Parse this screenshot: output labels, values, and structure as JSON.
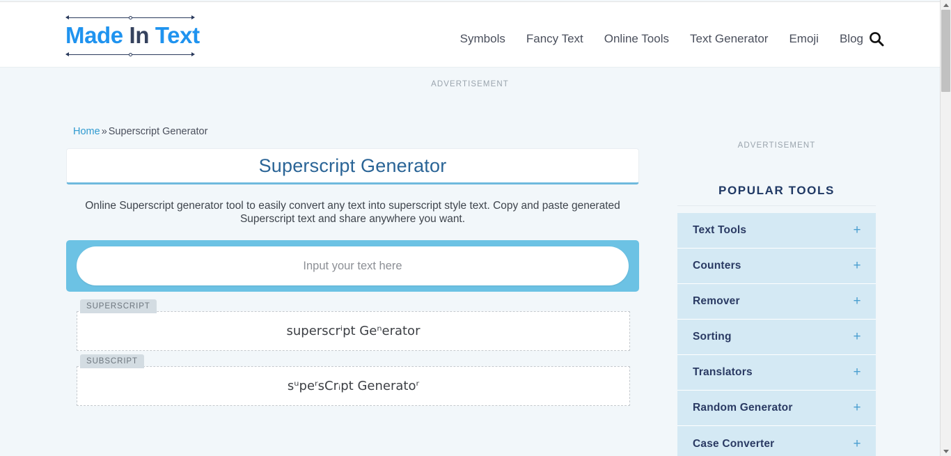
{
  "browser": {
    "scrollbar": {
      "up_arrow_icon": "chevron-up-icon",
      "down_arrow_icon": "chevron-down-icon"
    }
  },
  "header": {
    "logo": {
      "part1": "Made",
      "part2": "In",
      "part3": "Text",
      "color_primary": "#1f93ef",
      "color_secondary": "#35425e"
    },
    "nav": [
      {
        "label": "Symbols"
      },
      {
        "label": "Fancy Text"
      },
      {
        "label": "Online Tools"
      },
      {
        "label": "Text Generator"
      },
      {
        "label": "Emoji"
      },
      {
        "label": "Blog"
      }
    ],
    "search_icon": "search-icon"
  },
  "ads": {
    "top_label": "ADVERTISEMENT",
    "sidebar_label": "ADVERTISEMENT"
  },
  "breadcrumb": {
    "home": "Home",
    "separator": "»",
    "current": "Superscript Generator"
  },
  "tool": {
    "title": "Superscript Generator",
    "description": "Online Superscript generator tool to easily convert any text into superscript style text. Copy and paste generated Superscript text and share anywhere you want.",
    "input": {
      "placeholder": "Input your text here",
      "value": ""
    },
    "outputs": [
      {
        "tag": "SUPERSCRIPT",
        "text": "superscrⁱpt Geⁿerator"
      },
      {
        "tag": "SUBSCRIPT",
        "text": "sᵘpeʳsCrᵢpt Generatoʳ"
      }
    ]
  },
  "sidebar": {
    "title": "POPULAR TOOLS",
    "items": [
      {
        "label": "Text Tools",
        "toggle_icon": "plus-icon"
      },
      {
        "label": "Counters",
        "toggle_icon": "plus-icon"
      },
      {
        "label": "Remover",
        "toggle_icon": "plus-icon"
      },
      {
        "label": "Sorting",
        "toggle_icon": "plus-icon"
      },
      {
        "label": "Translators",
        "toggle_icon": "plus-icon"
      },
      {
        "label": "Random Generator",
        "toggle_icon": "plus-icon"
      },
      {
        "label": "Case Converter",
        "toggle_icon": "plus-icon"
      }
    ]
  },
  "colors": {
    "accent_blue": "#6cc2e4",
    "sidebar_item_bg": "#d4e9f4",
    "page_bg": "#f2f7fa",
    "title_text": "#2a6496"
  }
}
